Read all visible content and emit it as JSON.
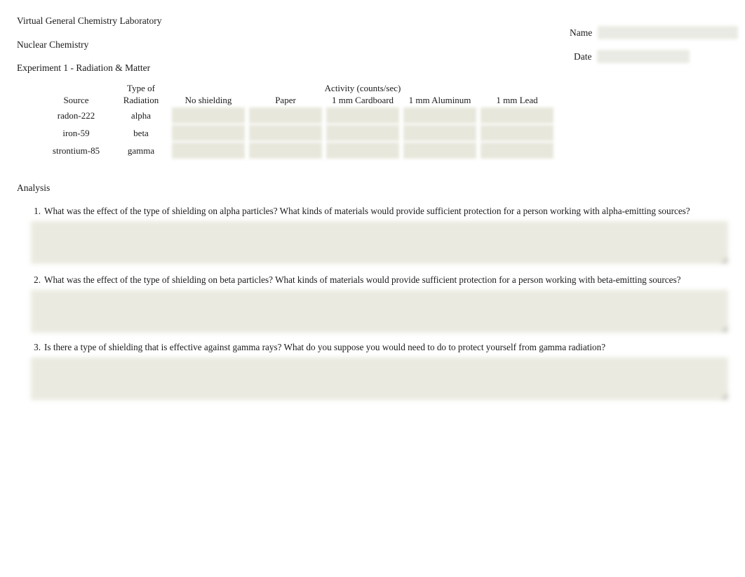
{
  "header": {
    "lines": [
      "Virtual General Chemistry Laboratory",
      "Nuclear Chemistry",
      "Experiment 1 - Radiation & Matter"
    ]
  },
  "student_fields": {
    "name": {
      "label": "Name",
      "value": "",
      "placeholder": ""
    },
    "date": {
      "label": "Date",
      "value": "",
      "placeholder": ""
    }
  },
  "data_table": {
    "group_header": "Activity (counts/sec)",
    "columns": [
      "Source",
      "Type of Radiation",
      "No shielding",
      "Paper",
      "1 mm Cardboard",
      "1 mm Aluminum",
      "1 mm Lead"
    ],
    "column_type_line1": "Type of",
    "column_type_line2": "Radiation",
    "rows": [
      {
        "source": "radon-222",
        "radiation": "alpha",
        "no_shielding": "",
        "paper": "",
        "cardboard": "",
        "aluminum": "",
        "lead": ""
      },
      {
        "source": "iron-59",
        "radiation": "beta",
        "no_shielding": "",
        "paper": "",
        "cardboard": "",
        "aluminum": "",
        "lead": ""
      },
      {
        "source": "strontium-85",
        "radiation": "gamma",
        "no_shielding": "",
        "paper": "",
        "cardboard": "",
        "aluminum": "",
        "lead": ""
      }
    ]
  },
  "analysis": {
    "heading": "Analysis",
    "questions": [
      {
        "number": "1.",
        "text": "What was the effect of the type of shielding on alpha particles? What kinds of materials would provide sufficient protection for a person working with alpha-emitting sources?",
        "answer": ""
      },
      {
        "number": "2.",
        "text": "What was the effect of the type of shielding on beta particles? What kinds of materials would provide sufficient protection for a person working with beta-emitting sources?",
        "answer": ""
      },
      {
        "number": "3.",
        "text": "Is there a type of shielding that is effective against gamma rays? What do you suppose you would need to do to protect yourself from gamma radiation?",
        "answer": ""
      }
    ]
  },
  "colors": {
    "page_background": "#ffffff",
    "text": "#1a1a1a",
    "input_fill": "#e6e6da",
    "answer_fill": "#e9e9df"
  }
}
